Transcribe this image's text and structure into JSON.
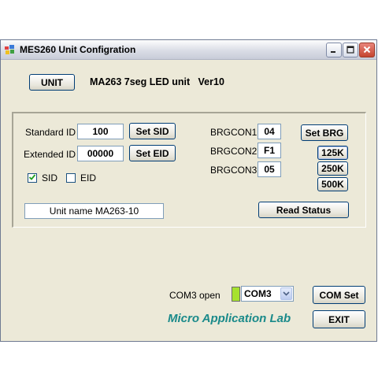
{
  "window": {
    "title": "MES260 Unit Configration",
    "unit_button": "UNIT",
    "unit_description": "MA263 7seg LED unit   Ver10"
  },
  "id_settings": {
    "standard_label": "Standard ID",
    "standard_value": "100",
    "set_sid_button": "Set SID",
    "extended_label": "Extended ID",
    "extended_value": "00000",
    "set_eid_button": "Set EID",
    "sid_checkbox_label": "SID",
    "sid_checked": true,
    "eid_checkbox_label": "EID",
    "eid_checked": false,
    "unit_name": "Unit name MA263-10"
  },
  "brg": {
    "con1_label": "BRGCON1",
    "con1_value": "04",
    "con2_label": "BRGCON2",
    "con2_value": "F1",
    "con3_label": "BRGCON3",
    "con3_value": "05",
    "set_brg_button": "Set BRG",
    "rate_125k": "125K",
    "rate_250k": "250K",
    "rate_500k": "500K",
    "read_status_button": "Read Status"
  },
  "com": {
    "status_text": "COM3 open",
    "indicator_color": "#a6e22e",
    "port_selected": "COM3",
    "com_set_button": "COM Set",
    "exit_button": "EXIT"
  },
  "brand": {
    "text": "Micro Application Lab",
    "color": "#1a8a8a"
  }
}
